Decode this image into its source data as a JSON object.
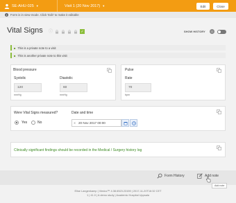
{
  "header": {
    "subject": "SE-AHU-025",
    "visit": "Visit 1 (20 Nov 2017)",
    "edit_label": "Edit",
    "close_label": "Close",
    "accent_color": "#f39c12"
  },
  "info_message": "Form is in view mode. Click 'Edit' to make it editable",
  "form": {
    "title": "Vital Signs",
    "show_history_label": "SHOW HISTORY",
    "history_count": "0",
    "title_icons": [
      "info-icon",
      "lock-icon",
      "lock-icon",
      "lock-icon",
      "lock-icon",
      "check-icon"
    ]
  },
  "notes": [
    "This is a private note to a visit",
    "This is another private note to this visit"
  ],
  "blood_pressure": {
    "title": "Blood pressure",
    "systolic_label": "Systolic",
    "systolic_value": "120",
    "systolic_unit": "mmHg",
    "diastolic_label": "Diastolic",
    "diastolic_value": "60",
    "diastolic_unit": "mmHg"
  },
  "pulse": {
    "title": "Pulse",
    "rate_label": "Rate",
    "rate_value": "70",
    "rate_unit": "bpm"
  },
  "measured": {
    "question": "Were Vital Signs measured?",
    "yes_label": "Yes",
    "no_label": "No",
    "selected": "Yes",
    "datetime_label": "Date and time",
    "datetime_value": "20 Nov 2017 00:00"
  },
  "findings_text": "Clinically significant findings should be recorded in the Medical / Surgery history log",
  "footer": {
    "form_history_label": "Form History",
    "add_note_label": "Add note",
    "tooltip": "Add note",
    "signature_line1": "Elise Langenkamp | Viedoc™ 4.38.6523.23159 | 2017-11-20T16:32 CET",
    "signature_line2": "1 | 41.0 | A demo study | Academic Hospital Uppsala"
  }
}
